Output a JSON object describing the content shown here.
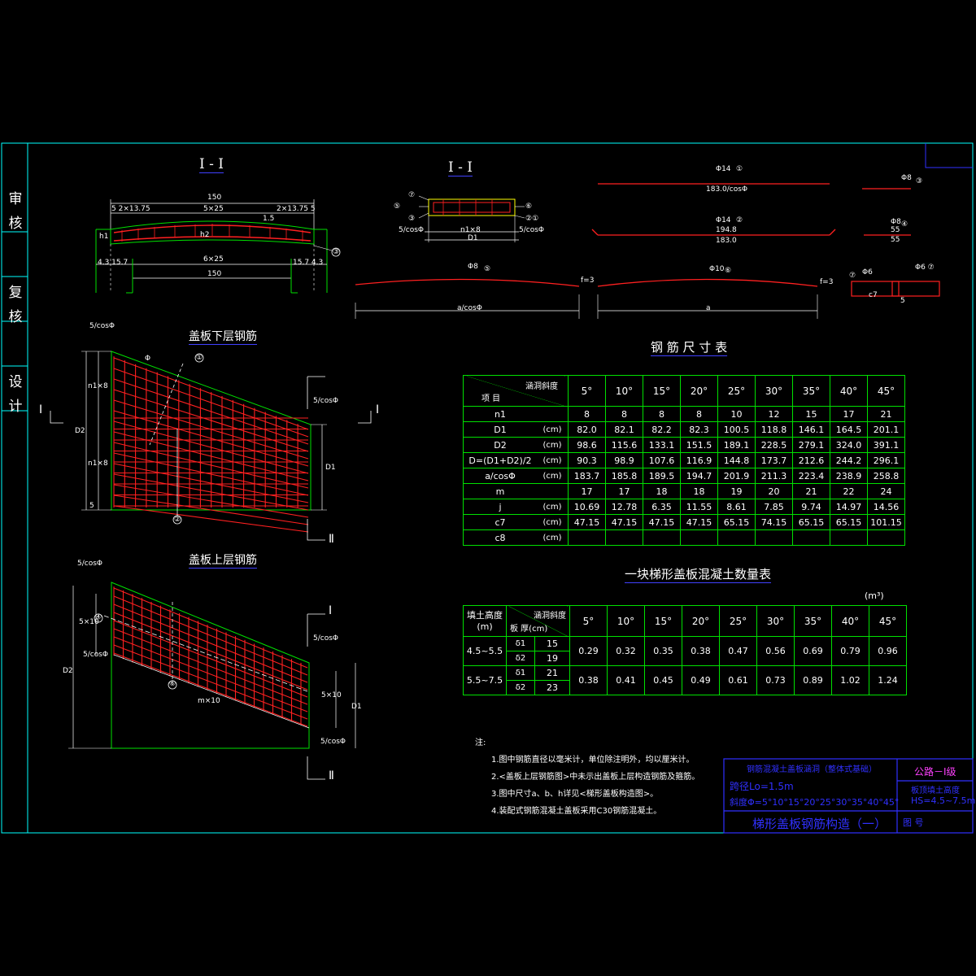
{
  "stamps": [
    "审核",
    "复核",
    "设计"
  ],
  "section_view": {
    "title": "I - I",
    "dims": {
      "overall_top": "150",
      "left_spans": "5 2×13.75",
      "mid_spans": "5×25",
      "right_spans": "2×13.75 5",
      "bottom_inner": "6×25",
      "bottom_overall": "150",
      "left_end": "4.3 15.7",
      "right_end": "15.7 4.3",
      "cover_top": "1.5",
      "h": "h1",
      "h2": "h2"
    },
    "callout": "③"
  },
  "cross_section": {
    "title": "I - I",
    "callouts_left": [
      "⑦",
      "⑤",
      "③"
    ],
    "callouts_right": [
      "⑥",
      "②①"
    ],
    "dim_left": "5/cosΦ",
    "dim_mid": "n1×8",
    "dim_right": "5/cosΦ",
    "dim_total": "D1"
  },
  "bar_details": [
    {
      "callout": "①",
      "dia": "Φ14",
      "length": "183.0/cosΦ"
    },
    {
      "callout": "②",
      "dia": "Φ14",
      "length": "194.8",
      "length2": "183.0"
    },
    {
      "callout": "③",
      "dia": "Φ8",
      "length": ""
    },
    {
      "callout": "④",
      "dia": "Φ8",
      "length": "55",
      "length2": "55"
    },
    {
      "callout": "⑤",
      "dia": "Φ8",
      "length": "a/cosΦ",
      "h": "f=3"
    },
    {
      "callout": "⑥",
      "dia": "Φ10",
      "length": "a",
      "h": "f=3"
    },
    {
      "callout": "⑦",
      "dia": "Φ6",
      "length": "c7",
      "extra": "Φ6 ⑦",
      "hook": "5"
    }
  ],
  "lower_plan": {
    "title": "盖板下层钢筋",
    "callouts": [
      "①",
      "②"
    ],
    "dims": {
      "top": "5/cosΦ",
      "upper": "n1×8",
      "lower": "n1×8",
      "side": "D2",
      "right": "D1",
      "right_top": "5/cosΦ",
      "bottom": "5"
    },
    "section_marks": [
      "I",
      "I",
      "Ⅱ"
    ],
    "angle": "Φ"
  },
  "upper_plan": {
    "title": "盖板上层钢筋",
    "callouts": [
      "④",
      "⑥"
    ],
    "dims": {
      "top": "5/cosΦ",
      "left": "5×10",
      "side": "D2",
      "right": "D1",
      "right_mid": "5×10",
      "bottom": "m×10",
      "slope_left": "5/cosΦ",
      "slope_right": "5/cosΦ",
      "right_top": "5/cosΦ"
    },
    "section_marks": [
      "I",
      "Ⅱ"
    ]
  },
  "rebar_table": {
    "title": "钢 筋 尺 寸 表",
    "header_diag_top": "涵洞斜度",
    "header_diag_bottom": "项 目",
    "angles": [
      "5°",
      "10°",
      "15°",
      "20°",
      "25°",
      "30°",
      "35°",
      "40°",
      "45°"
    ],
    "rows": [
      {
        "name": "n1",
        "unit": "",
        "values": [
          "8",
          "8",
          "8",
          "8",
          "10",
          "12",
          "15",
          "17",
          "21"
        ]
      },
      {
        "name": "D1",
        "unit": "(cm)",
        "values": [
          "82.0",
          "82.1",
          "82.2",
          "82.3",
          "100.5",
          "118.8",
          "146.1",
          "164.5",
          "201.1"
        ]
      },
      {
        "name": "D2",
        "unit": "(cm)",
        "values": [
          "98.6",
          "115.6",
          "133.1",
          "151.5",
          "189.1",
          "228.5",
          "279.1",
          "324.0",
          "391.1"
        ]
      },
      {
        "name": "D=(D1+D2)/2",
        "unit": "(cm)",
        "values": [
          "90.3",
          "98.9",
          "107.6",
          "116.9",
          "144.8",
          "173.7",
          "212.6",
          "244.2",
          "296.1"
        ]
      },
      {
        "name": "a/cosΦ",
        "unit": "(cm)",
        "values": [
          "183.7",
          "185.8",
          "189.5",
          "194.7",
          "201.9",
          "211.3",
          "223.4",
          "238.9",
          "258.8"
        ]
      },
      {
        "name": "m",
        "unit": "",
        "values": [
          "17",
          "17",
          "18",
          "18",
          "19",
          "20",
          "21",
          "22",
          "24"
        ]
      },
      {
        "name": "j",
        "unit": "(cm)",
        "values": [
          "10.69",
          "12.78",
          "6.35",
          "11.55",
          "8.61",
          "7.85",
          "9.74",
          "14.97",
          "14.56"
        ]
      },
      {
        "name": "c7",
        "unit": "(cm)",
        "values": [
          "47.15",
          "47.15",
          "47.15",
          "47.15",
          "65.15",
          "74.15",
          "65.15",
          "65.15",
          "101.15"
        ]
      },
      {
        "name": "c8",
        "unit": "(cm)",
        "values": [
          "",
          "",
          "",
          "",
          "",
          "",
          "",
          "",
          ""
        ]
      }
    ]
  },
  "concrete_table": {
    "title": "一块梯形盖板混凝土数量表",
    "unit": "(m³)",
    "header_fill": "填土高度",
    "header_fill_unit": "(m)",
    "header_diag_top": "涵洞斜度",
    "header_diag_bottom": "板 厚(cm)",
    "angles": [
      "5°",
      "10°",
      "15°",
      "20°",
      "25°",
      "30°",
      "35°",
      "40°",
      "45°"
    ],
    "groups": [
      {
        "fill": "4.5~5.5",
        "thick": [
          {
            "k": "δ1",
            "v": "15"
          },
          {
            "k": "δ2",
            "v": "19"
          }
        ],
        "values": [
          "0.29",
          "0.32",
          "0.35",
          "0.38",
          "0.47",
          "0.56",
          "0.69",
          "0.79",
          "0.96"
        ]
      },
      {
        "fill": "5.5~7.5",
        "thick": [
          {
            "k": "δ1",
            "v": "21"
          },
          {
            "k": "δ2",
            "v": "23"
          }
        ],
        "values": [
          "0.38",
          "0.41",
          "0.45",
          "0.49",
          "0.61",
          "0.73",
          "0.89",
          "1.02",
          "1.24"
        ]
      }
    ]
  },
  "notes": {
    "heading": "注:",
    "items": [
      "1.图中钢筋直径以毫米计，单位除注明外，均以厘米计。",
      "2.<盖板上层钢筋图>中未示出盖板上层构造钢筋及箍筋。",
      "3.图中尺寸a、b、h详见<梯形盖板构造图>。",
      "4.装配式钢筋混凝土盖板采用C30钢筋混凝土。"
    ]
  },
  "title_block": {
    "project": "钢筋混凝土盖板涵洞（整体式基础）",
    "span": "跨径Lo=1.5m",
    "skew": "斜度Φ=5°10°15°20°25°30°35°40°45°",
    "drawing_title": "梯形盖板钢筋构造（一）",
    "grade": "公路－Ⅰ级",
    "fill_label": "板顶填土高度",
    "fill_range": "HS=4.5~7.5m",
    "drawing_no": "图 号"
  },
  "colors": {
    "border": "#00ffff",
    "outline": "#00e000",
    "rebar": "#ff2020",
    "title_underline": "#4040ff",
    "accent_magenta": "#ff40ff",
    "title_block_blue": "#3030ff"
  }
}
